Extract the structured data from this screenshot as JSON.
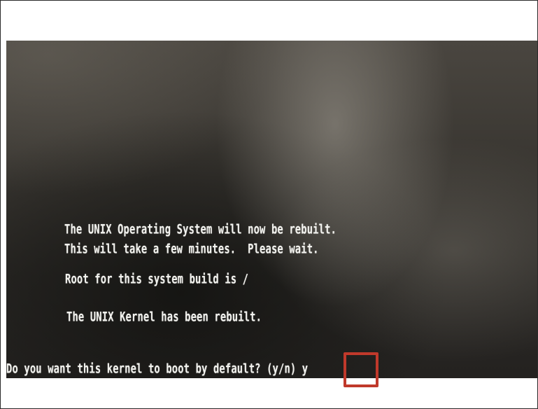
{
  "screen": {
    "lines": [
      "The UNIX Operating System will now be rebuilt.",
      "This will take a few minutes.  Please wait.",
      "Root for this system build is /",
      "The UNIX Kernel has been rebuilt."
    ],
    "prompt": "Do you want this kernel to boot by default? (y/n) y"
  },
  "colors": {
    "text": "#f2f2ee",
    "highlight": "#c0392b",
    "background": "#ffffff"
  }
}
